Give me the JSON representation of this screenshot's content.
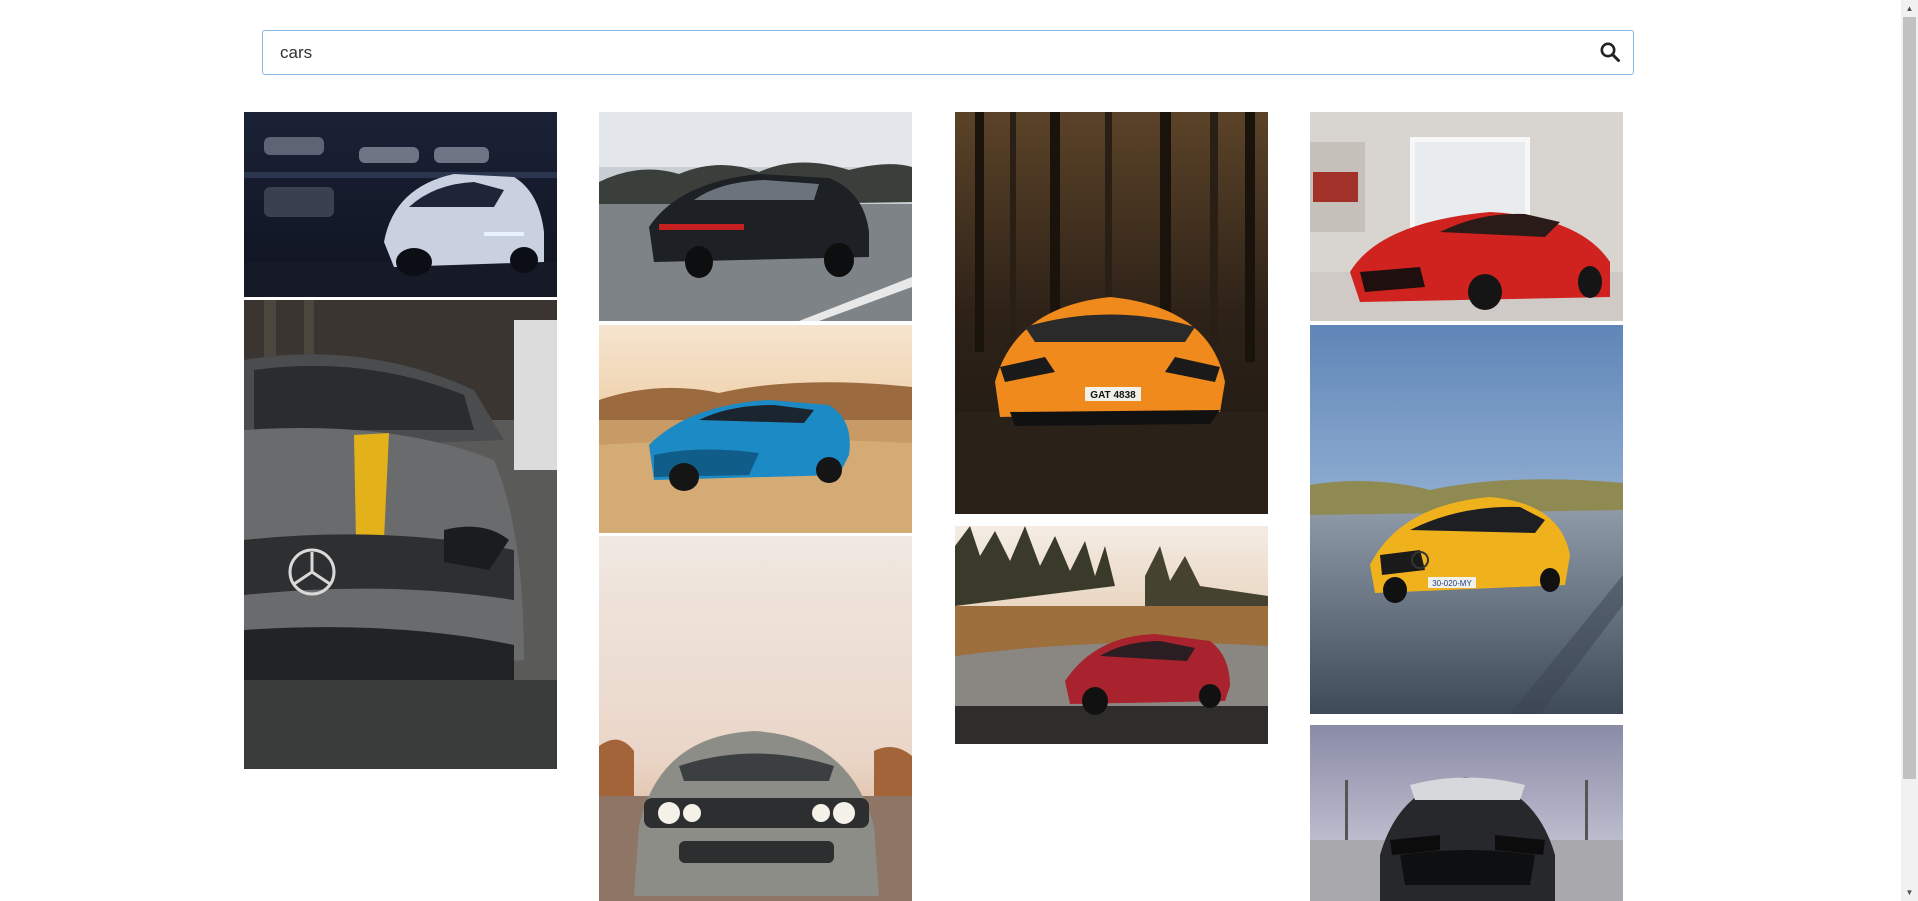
{
  "search": {
    "value": "cars",
    "placeholder": "",
    "icon": "search-icon"
  },
  "gallery": {
    "columns": [
      {
        "images": [
          {
            "alt": "silver Camaro in dark garage",
            "icon": "car-photo"
          },
          {
            "alt": "grey Mercedes-AMG with yellow stripe",
            "icon": "car-photo"
          }
        ]
      },
      {
        "images": [
          {
            "alt": "black Porsche Panamera on highway",
            "icon": "car-photo"
          },
          {
            "alt": "blue Camaro in desert",
            "icon": "car-photo"
          },
          {
            "alt": "grey Dodge Challenger front",
            "icon": "car-photo"
          }
        ]
      },
      {
        "images": [
          {
            "alt": "orange Lamborghini in forest",
            "icon": "car-photo"
          },
          {
            "alt": "red Mercedes-AMG GT among trees",
            "icon": "car-photo"
          }
        ]
      },
      {
        "images": [
          {
            "alt": "red Ferrari LaFerrari in showroom",
            "icon": "car-photo"
          },
          {
            "alt": "yellow Mercedes-AMG GT on road",
            "icon": "car-photo"
          },
          {
            "alt": "black Ford Mustang front",
            "icon": "car-photo"
          }
        ]
      }
    ]
  },
  "plates": {
    "lamborghini": "GAT 4838",
    "amg_yellow": "30-020-MY"
  },
  "colors": {
    "search_border": "#86b7e8",
    "scrollbar_track": "#f1f1f1",
    "scrollbar_thumb": "#c1c1c1"
  }
}
